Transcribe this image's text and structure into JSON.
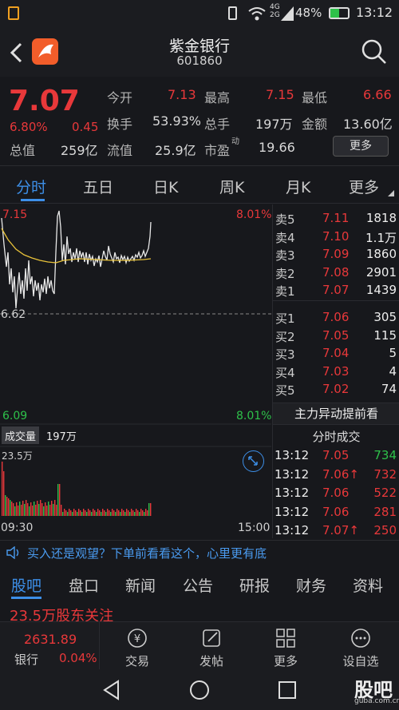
{
  "status": {
    "signal": "4G 2G",
    "battery": "48%",
    "time": "13:12"
  },
  "header": {
    "name": "紫金银行",
    "code": "601860"
  },
  "quote": {
    "price": "7.07",
    "change_pct": "6.80%",
    "change": "0.45",
    "mktcap_label": "总值",
    "mktcap": "259亿",
    "open_label": "今开",
    "open": "7.13",
    "high_label": "最高",
    "high": "7.15",
    "low_label": "最低",
    "low": "6.66",
    "turnover_label": "换手",
    "turnover": "53.93%",
    "volume_label": "总手",
    "volume": "197万",
    "amount_label": "金额",
    "amount": "13.60亿",
    "float_label": "流值",
    "float": "25.9亿",
    "pe_label": "市盈",
    "pe_sup": "动",
    "pe": "19.66",
    "more": "更多"
  },
  "tabs": [
    "分时",
    "五日",
    "日K",
    "周K",
    "月K",
    "更多"
  ],
  "chart": {
    "top_price": "7.15",
    "top_pct": "8.01%",
    "mid_price": "6.62",
    "bottom_price": "6.09",
    "bottom_pct": "8.01%",
    "vol_label": "成交量",
    "vol_value": "197万",
    "vol_max": "23.5万",
    "t_start": "09:30",
    "t_end": "15:00"
  },
  "book": {
    "asks": [
      {
        "label": "卖5",
        "price": "7.11",
        "vol": "1818"
      },
      {
        "label": "卖4",
        "price": "7.10",
        "vol": "1.1万"
      },
      {
        "label": "卖3",
        "price": "7.09",
        "vol": "1860"
      },
      {
        "label": "卖2",
        "price": "7.08",
        "vol": "2901"
      },
      {
        "label": "卖1",
        "price": "7.07",
        "vol": "1439"
      }
    ],
    "bids": [
      {
        "label": "买1",
        "price": "7.06",
        "vol": "305"
      },
      {
        "label": "买2",
        "price": "7.05",
        "vol": "115"
      },
      {
        "label": "买3",
        "price": "7.04",
        "vol": "5"
      },
      {
        "label": "买4",
        "price": "7.03",
        "vol": "4"
      },
      {
        "label": "买5",
        "price": "7.02",
        "vol": "74"
      }
    ],
    "main_force": "主力异动提前看",
    "ticks_title": "分时成交",
    "ticks": [
      {
        "time": "13:12",
        "price": "7.05",
        "vol": "734",
        "arrow": "",
        "color": "green"
      },
      {
        "time": "13:12",
        "price": "7.06",
        "vol": "732",
        "arrow": "↑",
        "color": "red"
      },
      {
        "time": "13:12",
        "price": "7.06",
        "vol": "522",
        "arrow": "",
        "color": "red"
      },
      {
        "time": "13:12",
        "price": "7.06",
        "vol": "281",
        "arrow": "",
        "color": "red"
      },
      {
        "time": "13:12",
        "price": "7.07",
        "vol": "250",
        "arrow": "↑",
        "color": "red"
      }
    ]
  },
  "notice": "买入还是观望？下单前看看这个，心里更有底",
  "subtabs": [
    "股吧",
    "盘口",
    "新闻",
    "公告",
    "研报",
    "财务",
    "资料"
  ],
  "peek_text": "23.5万股东关注",
  "index": {
    "value": "2631.89",
    "name": "银行",
    "pct": "0.04%"
  },
  "nav": [
    "交易",
    "发帖",
    "更多",
    "设自选"
  ],
  "watermark": "股吧",
  "watermark_url": "guba.com.cn"
}
